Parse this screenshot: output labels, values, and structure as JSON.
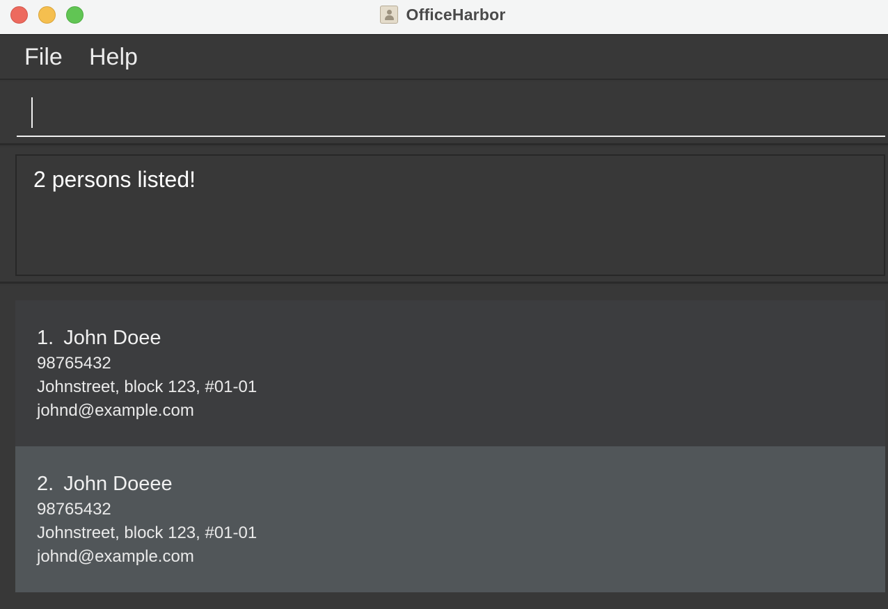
{
  "window": {
    "title": "OfficeHarbor",
    "app_icon": "address-book-icon",
    "traffic_lights": [
      "close",
      "minimize",
      "maximize"
    ]
  },
  "menu": {
    "items": [
      {
        "label": "File"
      },
      {
        "label": "Help"
      }
    ]
  },
  "command_box": {
    "value": "",
    "placeholder": ""
  },
  "result_display": {
    "text": "2 persons listed!"
  },
  "persons": [
    {
      "index": "1.",
      "name": "John Doee",
      "phone": "98765432",
      "address": "Johnstreet, block 123, #01-01",
      "email": "johnd@example.com"
    },
    {
      "index": "2.",
      "name": "John Doeee",
      "phone": "98765432",
      "address": "Johnstreet, block 123, #01-01",
      "email": "johnd@example.com"
    }
  ],
  "colors": {
    "background": "#363636",
    "titlebar": "#f4f5f5",
    "card_odd": "#3c3d3f",
    "card_selected": "#515659",
    "text": "#ffffff"
  }
}
